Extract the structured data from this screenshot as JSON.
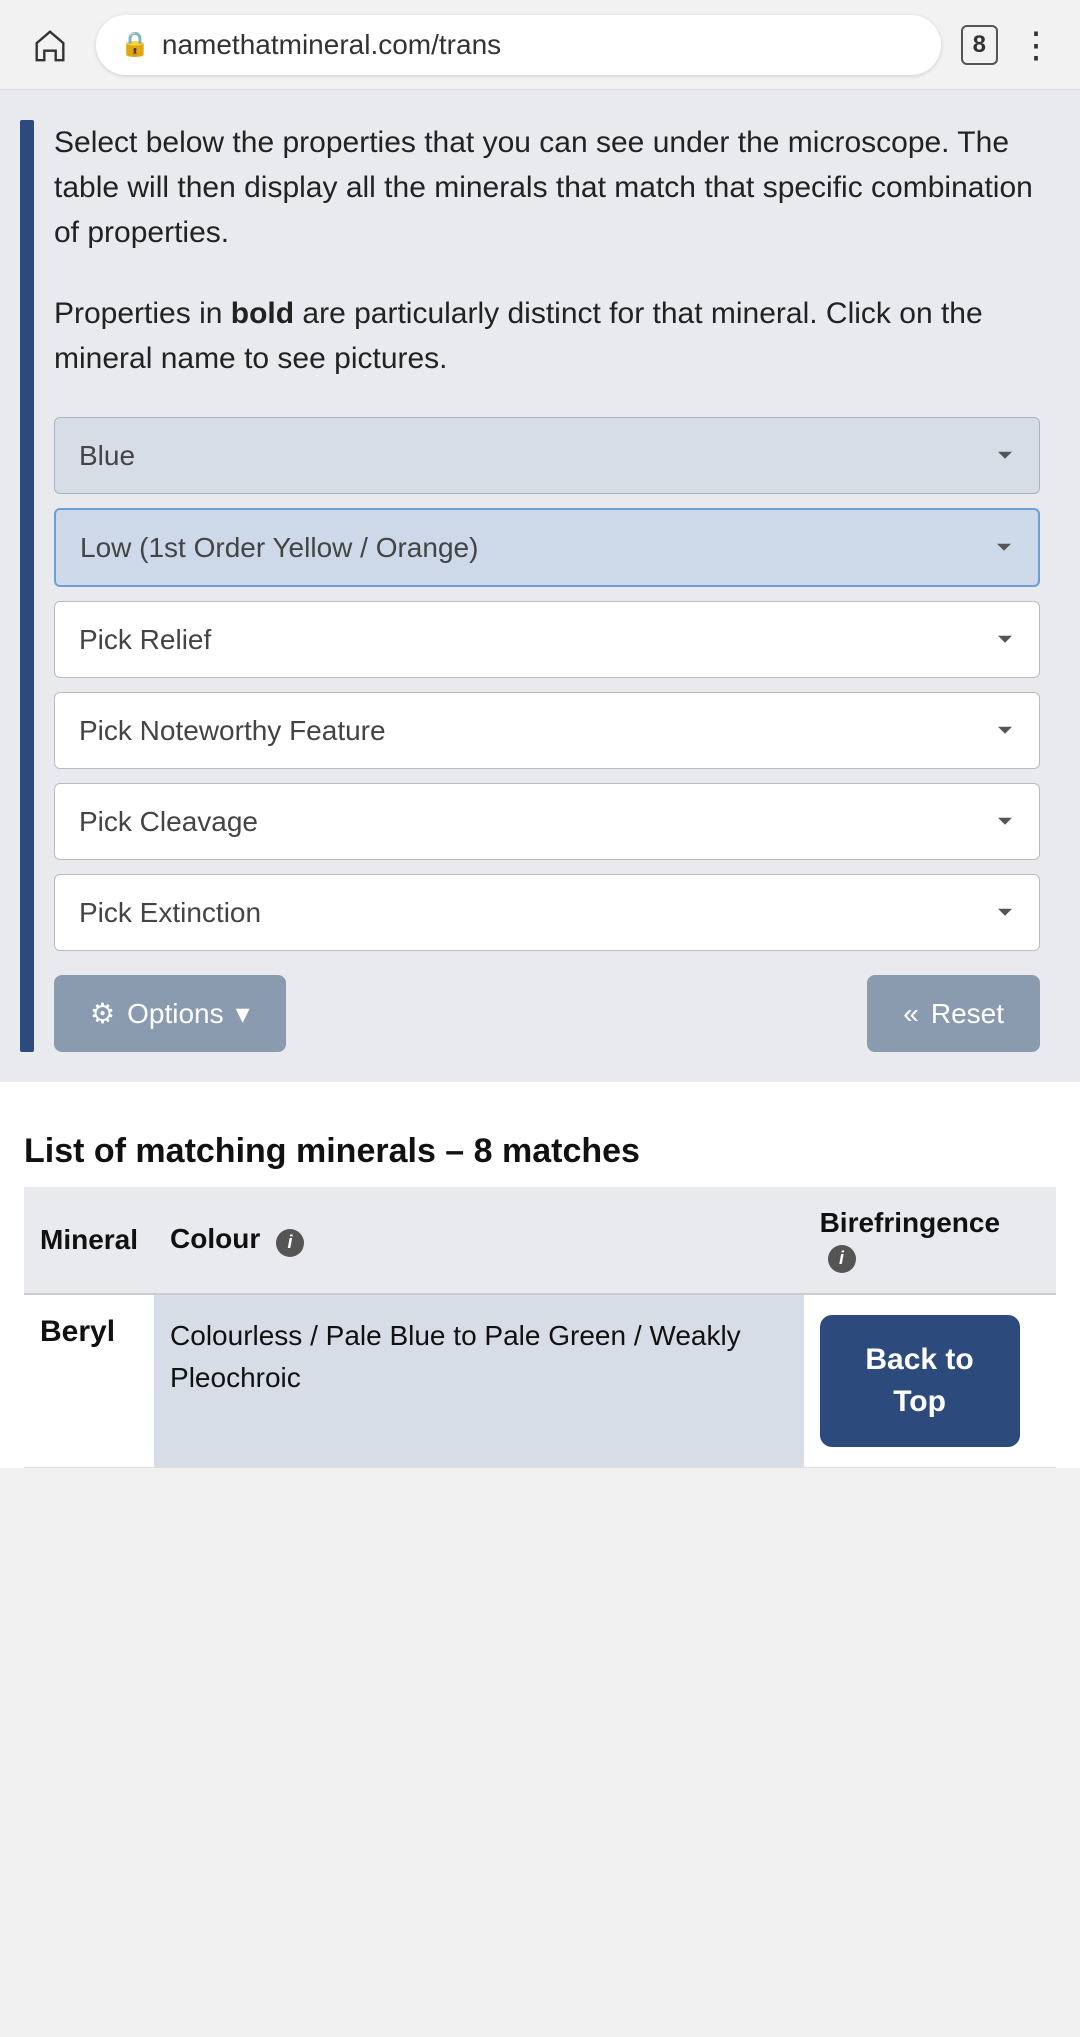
{
  "browser": {
    "url": "namethatmineral.com/trans",
    "tab_count": "8"
  },
  "intro": {
    "text1": "Select below the properties that you can see under the microscope. The table will then display all the minerals that match that specific combination of properties.",
    "text2_prefix": "Properties in ",
    "text2_bold": "bold",
    "text2_suffix": " are particularly distinct for that mineral. Click on the mineral name to see pictures."
  },
  "dropdowns": [
    {
      "id": "colour",
      "value": "Blue",
      "options": [
        "Blue"
      ]
    },
    {
      "id": "birefringence",
      "value": "Low (1st Order Yellow / Orange)",
      "options": [
        "Low (1st Order Yellow / Orange)"
      ],
      "highlighted": true
    },
    {
      "id": "relief",
      "value": "Pick Relief",
      "options": [
        "Pick Relief"
      ],
      "white": true
    },
    {
      "id": "noteworthy",
      "value": "Pick Noteworthy Feature",
      "options": [
        "Pick Noteworthy Feature"
      ],
      "white": true
    },
    {
      "id": "cleavage",
      "value": "Pick Cleavage",
      "options": [
        "Pick Cleavage"
      ],
      "white": true
    },
    {
      "id": "extinction",
      "value": "Pick Extinction",
      "options": [
        "Pick Extinction"
      ],
      "white": true
    }
  ],
  "buttons": {
    "options_label": "⚙ Options ▾",
    "reset_label": "« Reset"
  },
  "results": {
    "title": "List of matching minerals – 8 matches",
    "columns": [
      "Mineral",
      "Colour",
      "Birefringence"
    ],
    "rows": [
      {
        "mineral": "Beryl",
        "colour": "Colourless / Pale Blue to Pale Green / Weakly Pleochroic",
        "birefringence": ""
      }
    ]
  },
  "back_to_top": "Back to\nTop"
}
